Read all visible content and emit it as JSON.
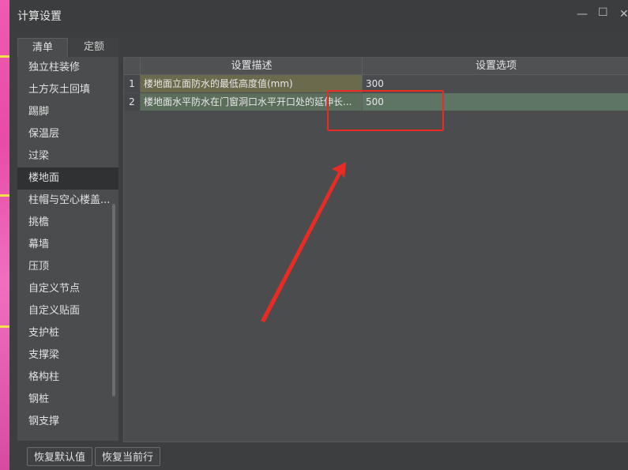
{
  "window": {
    "title": "计算设置",
    "minimize_glyph": "—",
    "maximize_glyph": "☐",
    "close_glyph": "✕"
  },
  "tabs": [
    {
      "label": "清单",
      "active": true
    },
    {
      "label": "定额",
      "active": false
    }
  ],
  "left_list": {
    "items": [
      "独立柱装修",
      "土方灰土回填",
      "踢脚",
      "保温层",
      "过梁",
      "楼地面",
      "柱帽与空心楼盖...",
      "挑檐",
      "幕墙",
      "压顶",
      "自定义节点",
      "自定义贴面",
      "支护桩",
      "支撑梁",
      "格构柱",
      "钢桩",
      "钢支撑"
    ],
    "selected": "楼地面"
  },
  "table": {
    "headers": {
      "description": "设置描述",
      "option": "设置选项"
    },
    "rows": [
      {
        "num": "1",
        "description": "楼地面立面防水的最低高度值(mm)",
        "option": "300"
      },
      {
        "num": "2",
        "description": "楼地面水平防水在门窗洞口水平开口处的延伸长...",
        "option": "500"
      }
    ]
  },
  "buttons": {
    "restore_default": "恢复默认值",
    "restore_row": "恢复当前行"
  },
  "colors": {
    "annotation": "#ea2b23",
    "selected_row": "#5f7564",
    "description_cell": "#6c6a4c"
  }
}
